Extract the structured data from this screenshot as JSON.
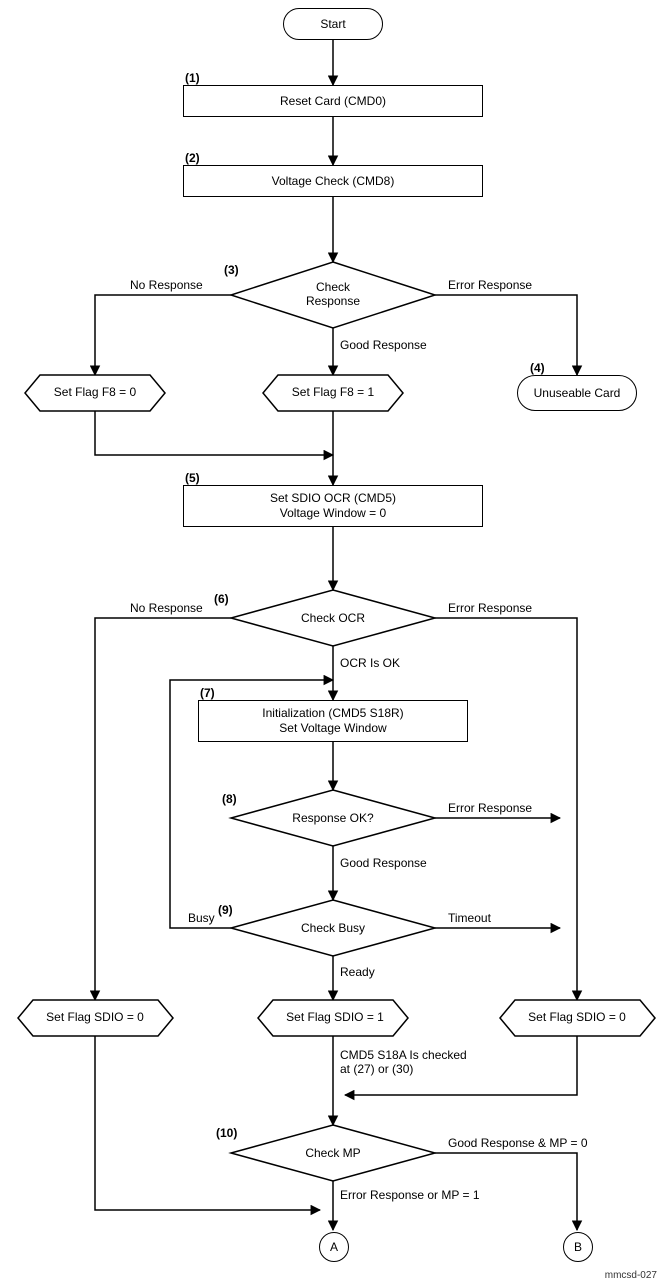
{
  "diagram_id": "mmcsd-027",
  "terminators": {
    "start": "Start",
    "unuseable": "Unuseable Card"
  },
  "steps": {
    "s1": {
      "num": "(1)",
      "label": "Reset Card (CMD0)"
    },
    "s2": {
      "num": "(2)",
      "label": "Voltage Check (CMD8)"
    },
    "s3": {
      "num": "(3)",
      "label": "Check\nResponse"
    },
    "s4": {
      "num": "(4)"
    },
    "s5": {
      "num": "(5)",
      "label": "Set SDIO OCR (CMD5)\nVoltage Window = 0"
    },
    "s6": {
      "num": "(6)",
      "label": "Check OCR"
    },
    "s7": {
      "num": "(7)",
      "label": "Initialization (CMD5 S18R)\nSet Voltage Window"
    },
    "s8": {
      "num": "(8)",
      "label": "Response OK?"
    },
    "s9": {
      "num": "(9)",
      "label": "Check Busy"
    },
    "s10": {
      "num": "(10)",
      "label": "Check MP"
    }
  },
  "flags": {
    "f8_0": "Set Flag F8 = 0",
    "f8_1": "Set Flag F8 = 1",
    "sdio0_left": "Set Flag SDIO = 0",
    "sdio1": "Set Flag SDIO = 1",
    "sdio0_right": "Set Flag SDIO = 0"
  },
  "edges": {
    "noResponse": "No Response",
    "errorResponse": "Error Response",
    "goodResponse": "Good Response",
    "ocrOk": "OCR Is OK",
    "busy": "Busy",
    "timeout": "Timeout",
    "ready": "Ready",
    "goodMp0": "Good Response & MP = 0",
    "errMp1": "Error Response or MP = 1"
  },
  "note": "CMD5 S18A Is checked\nat (27) or (30)",
  "connectors": {
    "A": "A",
    "B": "B"
  }
}
